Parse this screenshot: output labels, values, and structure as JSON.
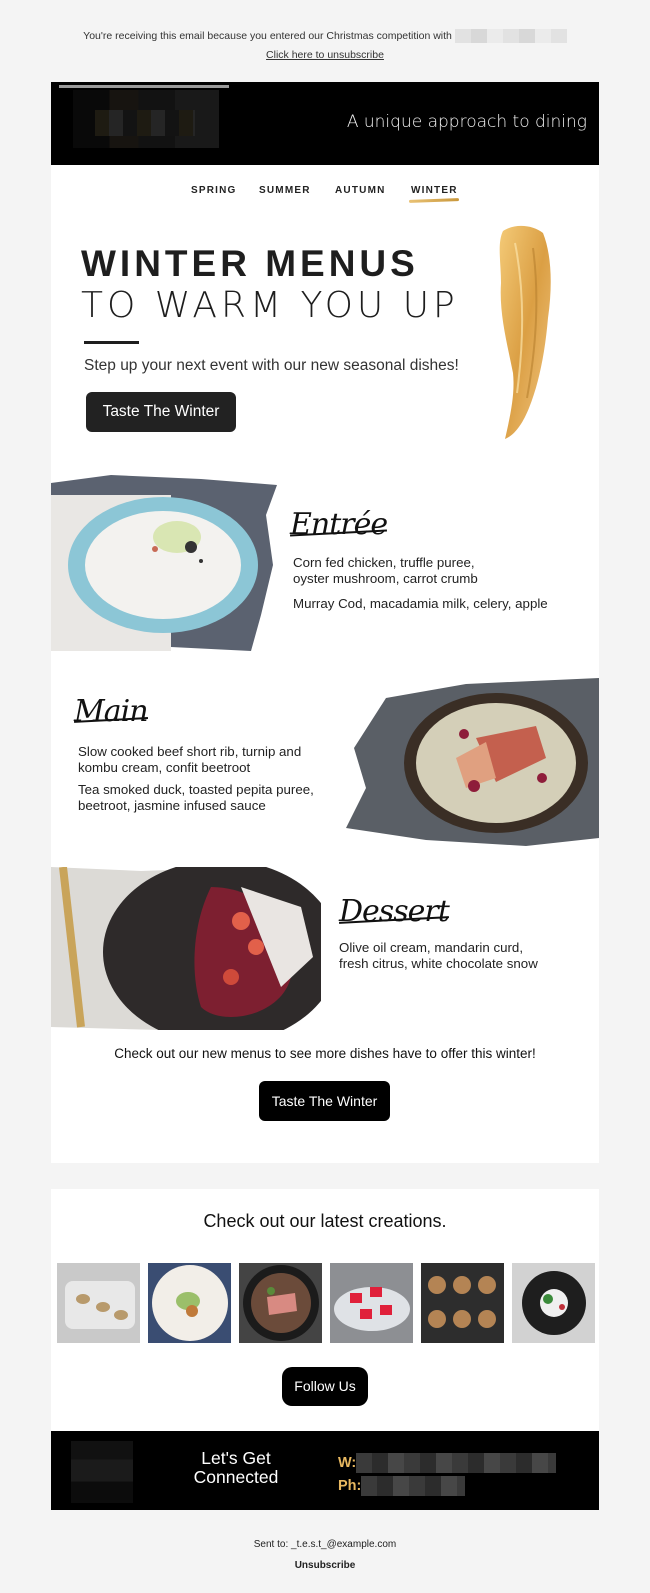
{
  "preheader": {
    "notice": "You're receiving this email because you entered our Christmas competition with",
    "unsubscribe_link": "Click here to unsubscribe"
  },
  "header": {
    "tagline": "A unique approach to dining"
  },
  "nav": {
    "items": [
      "SPRING",
      "SUMMER",
      "AUTUMN",
      "WINTER"
    ],
    "active": "WINTER"
  },
  "hero": {
    "title_line1": "WINTER MENUS",
    "title_line2": "TO WARM YOU UP",
    "subtitle": "Step up your next event with our new seasonal dishes!",
    "cta": "Taste The Winter"
  },
  "courses": [
    {
      "heading": "Entrée",
      "dishes": [
        "Corn fed chicken, truffle puree,",
        "oyster mushroom, carrot crumb",
        "Murray Cod, macadamia milk, celery, apple"
      ]
    },
    {
      "heading": "Main",
      "dishes": [
        "Slow cooked beef short rib, turnip and",
        "kombu  cream, confit beetroot",
        "Tea smoked duck, toasted pepita puree,",
        "beetroot, jasmine infused sauce"
      ]
    },
    {
      "heading": "Dessert",
      "dishes": [
        "Olive oil cream, mandarin curd,",
        "fresh citrus, white chocolate snow"
      ]
    }
  ],
  "closing": {
    "text": "Check out our new menus to see more dishes have to offer this winter!",
    "cta": "Taste The Winter"
  },
  "gallery": {
    "title": "Check out our latest creations.",
    "cta": "Follow Us"
  },
  "footer": {
    "heading_line1": "Let's Get",
    "heading_line2": "Connected",
    "web_label": "W:",
    "phone_label": "Ph:"
  },
  "post_footer": {
    "sent_to": "Sent to: _t.e.s.t_@example.com",
    "unsubscribe": "Unsubscribe"
  },
  "colors": {
    "accent_gold": "#e8b860",
    "dark": "#000000"
  }
}
